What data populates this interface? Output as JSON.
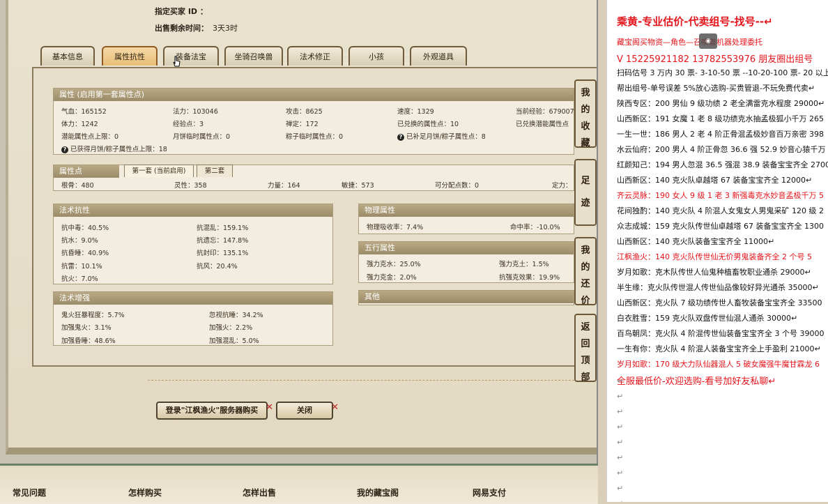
{
  "seller": {
    "buyer_label": "指定买家 ID ：",
    "time_label": "出售剩余时间：",
    "time_value": "3天3时"
  },
  "tabs": [
    {
      "label": "基本信息"
    },
    {
      "label": "属性抗性"
    },
    {
      "label": "装备法宝"
    },
    {
      "label": "坐骑召唤兽"
    },
    {
      "label": "法术修正"
    },
    {
      "label": "小孩"
    },
    {
      "label": "外观道具"
    }
  ],
  "attr": {
    "header": "属性 (启用第一套属性点)",
    "row1": [
      "气血：165152",
      "法力：103046",
      "攻击：8625",
      "速度：1329",
      "当前经验：679007"
    ],
    "row2": [
      "体力：1242",
      "经验点：3",
      "禅定：172",
      "已兑换的属性点：10",
      "已兑换潜能属性点"
    ],
    "row3": [
      "潜能属性点上限：0",
      "月饼临时属性点：0",
      "粽子临时属性点：0",
      "已补足月饼/粽子属性点：8"
    ],
    "row4": "已获得月饼/粽子属性点上限：18"
  },
  "points": {
    "header": "属性点",
    "tab1": "第一套 (当前启用)",
    "tab2": "第二套",
    "row": [
      "根骨：480",
      "灵性：358",
      "力量：164",
      "敏捷：573",
      "可分配点数：0",
      "定力："
    ]
  },
  "resist": {
    "header": "法术抗性",
    "rows": [
      [
        "抗中毒：40.5%",
        "抗混乱：159.1%"
      ],
      [
        "抗水：9.0%",
        "抗遗忘：147.8%"
      ],
      [
        "抗昏睡：40.9%",
        "抗封印：135.1%"
      ],
      [
        "抗雷：10.1%",
        "抗风：20.4%"
      ],
      [
        "抗火：7.0%",
        ""
      ]
    ]
  },
  "enhance": {
    "header": "法术增强",
    "rows": [
      [
        "鬼火狂暴程度：5.7%",
        "忽视抗睡：34.2%"
      ],
      [
        "加强鬼火：3.1%",
        "加强火：2.2%"
      ],
      [
        "加强昏睡：48.6%",
        "加强混乱：5.0%"
      ]
    ]
  },
  "physical": {
    "header": "物理属性",
    "row": [
      "物理吸收率：7.4%",
      "命中率：-10.0%"
    ]
  },
  "five": {
    "header": "五行属性",
    "rows": [
      [
        "强力克水：25.0%",
        "强力克土：1.5%"
      ],
      [
        "强力克金：2.0%",
        "抗强克效果：19.9%"
      ]
    ]
  },
  "other": {
    "header": "其他"
  },
  "side_buttons": [
    {
      "chars": [
        "我",
        "的",
        "收",
        "藏"
      ]
    },
    {
      "chars": [
        "足",
        "迹"
      ]
    },
    {
      "chars": [
        "我",
        "的",
        "还",
        "价"
      ]
    },
    {
      "chars": [
        "返",
        "回",
        "顶",
        "部"
      ]
    }
  ],
  "actions": {
    "login": "登录\"江枫渔火\"服务器购买",
    "close": "关闭"
  },
  "footer": [
    "常见问题",
    "怎样购买",
    "怎样出售",
    "我的藏宝阁",
    "网易支付"
  ],
  "doc": {
    "lines": [
      {
        "text": "乘黄-专业估价-代卖组号-找号--↵",
        "style": "red big"
      },
      {
        "text": "藏宝阁买物资—角色—召唤兽机器处理委托",
        "style": "red"
      },
      {
        "text": "V 15225921182   13782553976 朋友圈出组号",
        "style": "red mid"
      },
      {
        "text": "扫码估号 3 万内 30 票- 3-10-50 票  --10-20-100 票- 20 以上",
        "style": ""
      },
      {
        "text": "帮出组号-单号误差 5%放心选购-买贵管退-不玩免费代卖↵",
        "style": ""
      },
      {
        "text": "陕西专区：200 男仙 9 级功绩 2 老全满雷克水程度 29000↵",
        "style": ""
      },
      {
        "text": "山西新区：191 女魔 1 老 8 级功绩克水抽孟极狐小千万 265",
        "style": ""
      },
      {
        "text": "一生一世：186 男人 2 老 4 阶正骨混孟极妙音百万亲密 398",
        "style": ""
      },
      {
        "text": "水云仙府：200 男人 4 阶正骨忽 36.6 强 52.9 妙音心猿千万",
        "style": ""
      },
      {
        "text": "红颜知己：194 男人忽混 36.5 强混 38.9 装备宝宝齐全 2700",
        "style": ""
      },
      {
        "text": "山西新区：140 克火队卓越塔 67 装备宝宝齐全 12000↵",
        "style": ""
      },
      {
        "text": "齐云灵脉：190 女人 9 级 1 老 3 新强毒克水妙音孟极千万 5",
        "style": "red"
      },
      {
        "text": "花间独酌：140 克火队 4 阶混人女鬼女人男鬼采矿 120 级 2",
        "style": ""
      },
      {
        "text": "众志成城：159 克火队传世仙卓越塔 67 装备宝宝齐全 1300",
        "style": ""
      },
      {
        "text": "山西新区：140 克火队装备宝宝齐全 11000↵",
        "style": ""
      },
      {
        "text": "江枫渔火：140 克火队传世仙无价男鬼装备齐全 2 个号 5",
        "style": "red"
      },
      {
        "text": "岁月如歌：克木队传世人仙鬼种植畜牧职业通杀 29000↵",
        "style": ""
      },
      {
        "text": "半生缘：克火队传世混人传世仙品像较好异光通杀 35000↵",
        "style": ""
      },
      {
        "text": "山西新区：克火队 7 级功绩传世人畜牧装备宝宝齐全 33500",
        "style": ""
      },
      {
        "text": "白衣胜雪：159 克火队双盘传世仙混人通杀 30000↵",
        "style": ""
      },
      {
        "text": "百鸟朝凤：克火队 4 阶混传世仙装备宝宝齐全 3 个号 39000",
        "style": ""
      },
      {
        "text": "一生有你：克火队 4 阶混人装备宝宝齐全上手盈利 21000↵",
        "style": ""
      },
      {
        "text": "岁月如歌：170 级大力队仙器混人 5 破女魔强牛魔甘霖龙 6",
        "style": "red"
      },
      {
        "text": "全服最低价-欢迎选购-看号加好友私聊↵",
        "style": "red mid"
      }
    ],
    "para_marks": [
      "↵",
      "↵",
      "↵",
      "↵",
      "↵",
      "↵",
      "↵",
      "↵",
      "↵"
    ]
  }
}
